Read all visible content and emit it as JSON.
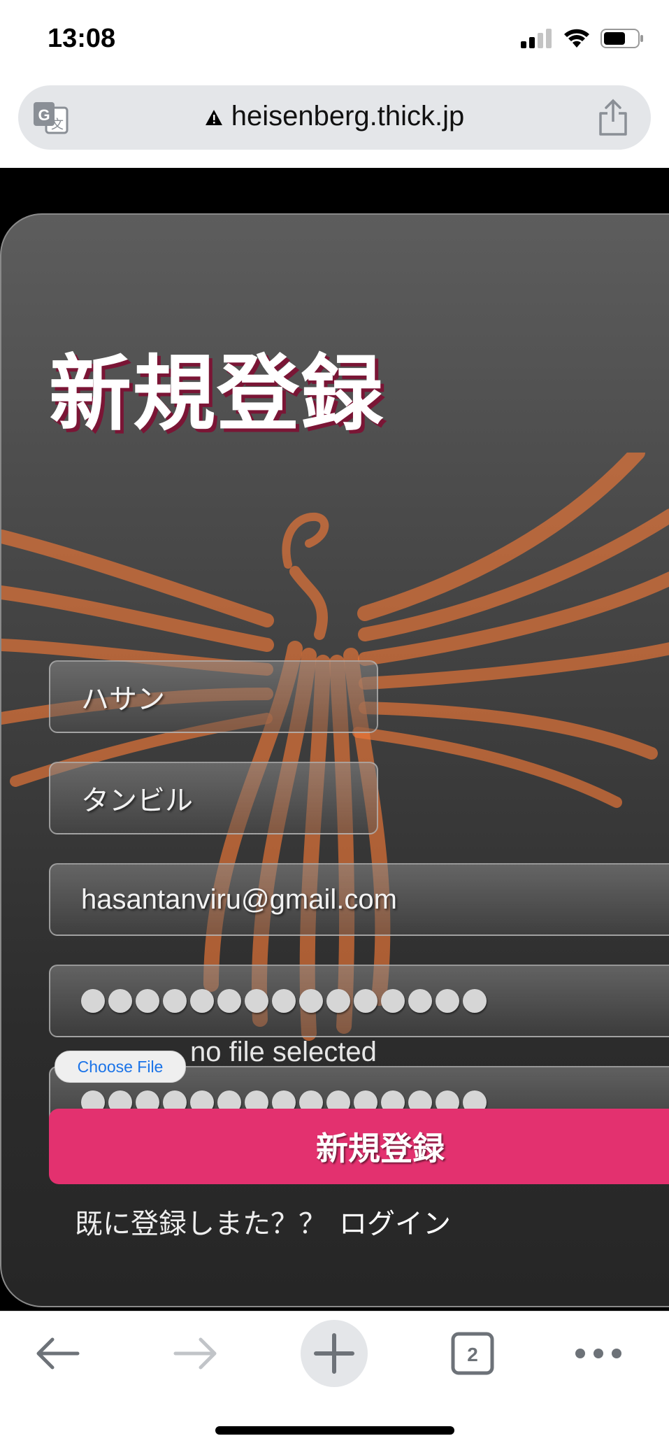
{
  "status_bar": {
    "time": "13:08"
  },
  "browser": {
    "url": "heisenberg.thick.jp"
  },
  "form": {
    "title": "新規登録",
    "first_name": "ハサン",
    "last_name": "タンビル",
    "email": "hasantanviru@gmail.com",
    "password_dot_count": 15,
    "confirm_password_dot_count": 15,
    "file_button_label": "Choose File",
    "file_status": "no file selected",
    "submit_label": "新規登録",
    "login_prompt": "既に登録しまた？？",
    "login_link": "ログイン"
  },
  "toolbar": {
    "tab_count": "2"
  },
  "colors": {
    "accent": "#e3316f",
    "title_shadow": "#7a1535",
    "phoenix": "#f07838"
  }
}
